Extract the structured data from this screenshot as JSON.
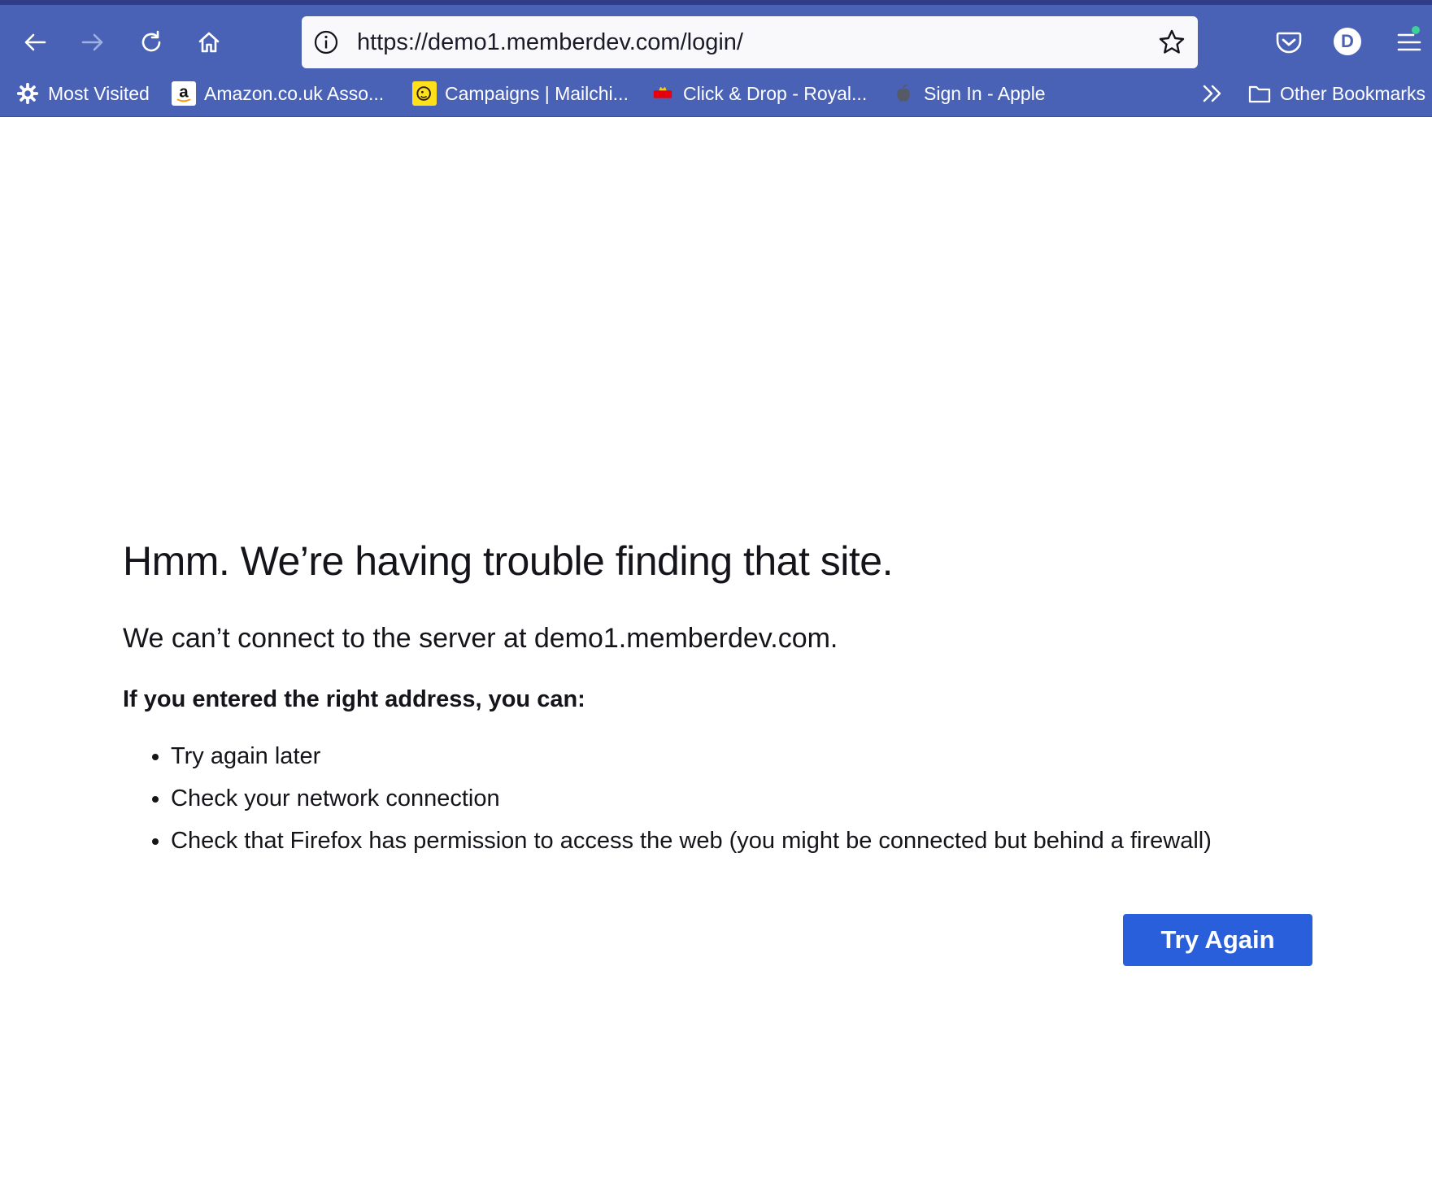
{
  "browser": {
    "url": "https://demo1.memberdev.com/login/",
    "profile_initial": "D",
    "toolbar_color": "#4a62b6",
    "icons": {
      "back": "back-arrow-icon",
      "forward": "forward-arrow-icon",
      "reload": "reload-icon",
      "home": "home-icon",
      "site_info": "info-icon",
      "bookmark": "star-icon",
      "pocket": "pocket-icon",
      "menu": "hamburger-menu-icon",
      "overflow": "double-chevron-icon"
    }
  },
  "bookmarks": {
    "items": [
      {
        "label": "Most Visited",
        "icon": "gear-icon"
      },
      {
        "label": "Amazon.co.uk Asso...",
        "icon": "amazon-icon"
      },
      {
        "label": "Campaigns | Mailchi...",
        "icon": "mailchimp-icon"
      },
      {
        "label": "Click & Drop - Royal...",
        "icon": "royal-mail-icon"
      },
      {
        "label": "Sign In - Apple",
        "icon": "apple-icon"
      }
    ],
    "other_label": "Other Bookmarks"
  },
  "error": {
    "title": "Hmm. We’re having trouble finding that site.",
    "description": "We can’t connect to the server at demo1.memberdev.com.",
    "subheading": "If you entered the right address, you can:",
    "suggestions": [
      "Try again later",
      "Check your network connection",
      "Check that Firefox has permission to access the web (you might be connected but behind a firewall)"
    ],
    "button_label": "Try Again",
    "button_color": "#2a5fdb"
  }
}
